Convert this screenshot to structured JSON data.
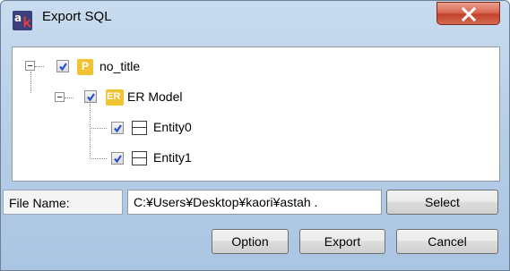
{
  "window": {
    "title": "Export SQL",
    "icon": "astah-app-icon"
  },
  "tree": {
    "root": {
      "label": "no_title",
      "icon_letter": "P",
      "checked": true
    },
    "model": {
      "label": "ER Model",
      "icon_letter": "ER",
      "checked": true
    },
    "entities": [
      {
        "label": "Entity0",
        "checked": true
      },
      {
        "label": "Entity1",
        "checked": true
      }
    ]
  },
  "file": {
    "label": "File Name:",
    "value": "C:¥Users¥Desktop¥kaori¥astah ."
  },
  "buttons": {
    "select": "Select",
    "option": "Option",
    "export": "Export",
    "cancel": "Cancel"
  },
  "colors": {
    "checkmark": "#2a4fd0",
    "folder_icon": "#f1c232",
    "close_button": "#c2432c"
  }
}
